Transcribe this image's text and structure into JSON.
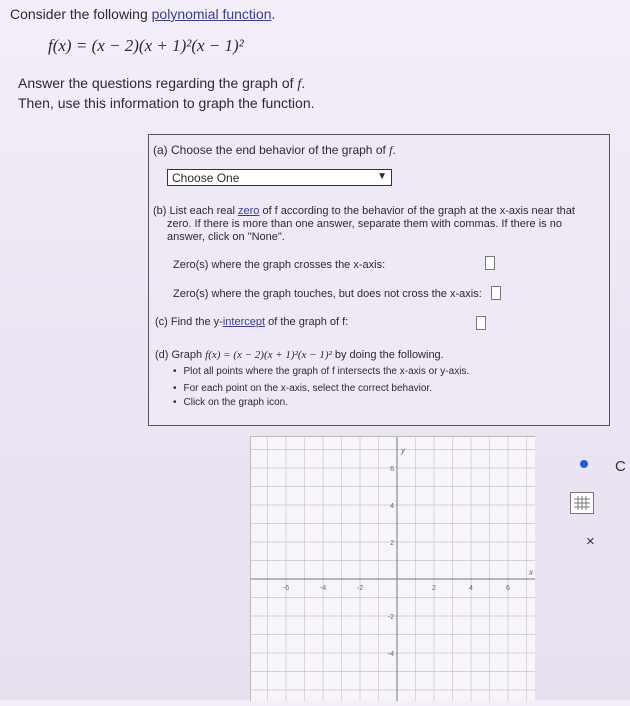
{
  "intro": {
    "prefix": "Consider the following ",
    "link": "polynomial function",
    "suffix": "."
  },
  "function": "f(x) = (x − 2)(x + 1)²(x − 1)²",
  "answer_text": {
    "line1": "Answer the questions regarding the graph of ",
    "f": "f",
    "line1_end": ".",
    "line2": "Then, use this information to graph the function."
  },
  "part_a": {
    "label": "(a) Choose the end behavior of the graph of ",
    "f": "f",
    "end": ".",
    "select_value": "Choose One"
  },
  "part_b": {
    "label_a": "(b) List each real ",
    "zero": "zero",
    "label_b": " of f according to the behavior of the graph at the x-axis near that",
    "line2": "zero. If there is more than one answer, separate them with commas. If there is no",
    "line3": "answer, click on \"None\".",
    "crosses": "Zero(s) where the graph crosses the x-axis:",
    "touches": "Zero(s) where the graph touches, but does not cross the x-axis:"
  },
  "part_c": {
    "label_a": "(c) Find the y-",
    "intercept": "intercept",
    "label_b": " of the graph of f:"
  },
  "part_d": {
    "label_a": "(d) Graph ",
    "function": "f(x) = (x − 2)(x + 1)²(x − 1)²",
    "label_b": " by doing the following.",
    "bullets": [
      "Plot all points where the graph of f intersects the x-axis or y-axis.",
      "For each point on the x-axis, select the correct behavior.",
      "Click on the graph icon."
    ]
  },
  "graph": {
    "x_ticks": [
      "-6",
      "-4",
      "-2",
      "2",
      "4",
      "6"
    ],
    "y_ticks": [
      "6",
      "4",
      "2",
      "-2",
      "-4"
    ],
    "x_label": "x",
    "y_label": "y"
  },
  "tools": {
    "close_label": "×",
    "partial_icon_label": "C"
  }
}
